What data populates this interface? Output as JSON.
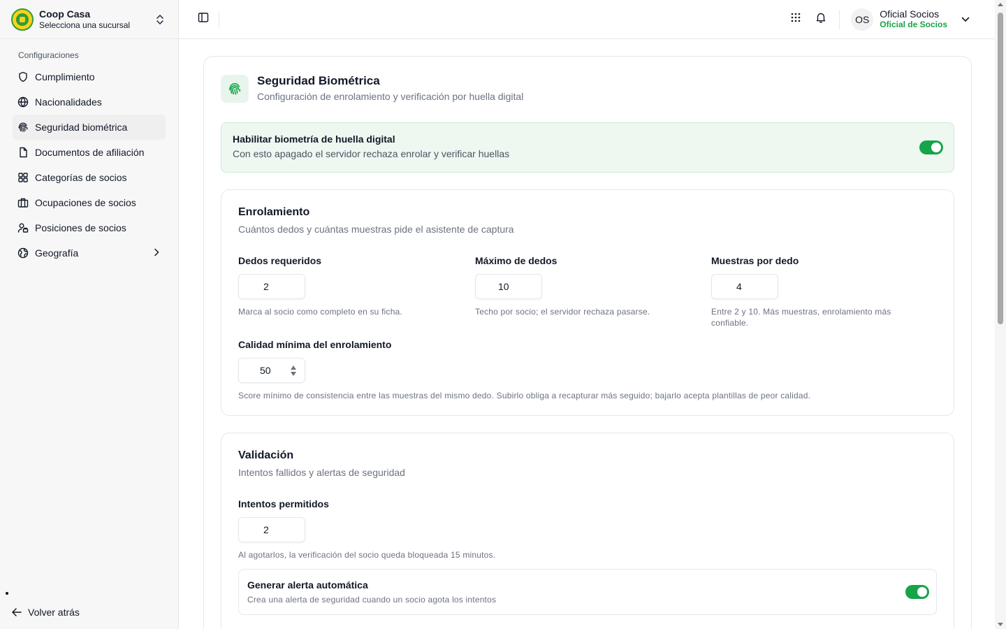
{
  "brand": {
    "name": "Coop Casa",
    "subtitle": "Selecciona una sucursal"
  },
  "sidebar": {
    "section_title": "Configuraciones",
    "items": [
      {
        "label": "Cumplimiento",
        "icon": "shield-icon"
      },
      {
        "label": "Nacionalidades",
        "icon": "globe-icon"
      },
      {
        "label": "Seguridad biométrica",
        "icon": "fingerprint-icon",
        "active": true
      },
      {
        "label": "Documentos de afiliación",
        "icon": "document-icon"
      },
      {
        "label": "Categorías de socios",
        "icon": "grid-icon"
      },
      {
        "label": "Ocupaciones de socios",
        "icon": "briefcase-icon"
      },
      {
        "label": "Posiciones de socios",
        "icon": "users-icon"
      },
      {
        "label": "Geografía",
        "icon": "earth-icon",
        "has_submenu": true
      }
    ],
    "back_label": "Volver atrás"
  },
  "topbar": {
    "user": {
      "initials": "OS",
      "name": "Oficial Socios",
      "role": "Oficial de Socios"
    }
  },
  "card": {
    "title": "Seguridad Biométrica",
    "subtitle": "Configuración de enrolamiento y verificación por huella digital",
    "enable": {
      "title": "Habilitar biometría de huella digital",
      "subtitle": "Con esto apagado el servidor rechaza enrolar y verificar huellas",
      "on": true
    },
    "enrollment": {
      "title": "Enrolamiento",
      "subtitle": "Cuántos dedos y cuántas muestras pide el asistente de captura",
      "fields": [
        {
          "label": "Dedos requeridos",
          "value": "2",
          "help": "Marca al socio como completo en su ficha."
        },
        {
          "label": "Máximo de dedos",
          "value": "10",
          "help": "Techo por socio; el servidor rechaza pasarse."
        },
        {
          "label": "Muestras por dedo",
          "value": "4",
          "help": "Entre 2 y 10. Más muestras, enrolamiento más confiable."
        }
      ],
      "quality": {
        "label": "Calidad mínima del enrolamiento",
        "value": "50",
        "help": "Score mínimo de consistencia entre las muestras del mismo dedo. Subirlo obliga a recapturar más seguido; bajarlo acepta plantillas de peor calidad."
      }
    },
    "validation": {
      "title": "Validación",
      "subtitle": "Intentos fallidos y alertas de seguridad",
      "attempts": {
        "label": "Intentos permitidos",
        "value": "2",
        "help": "Al agotarlos, la verificación del socio queda bloqueada 15 minutos."
      },
      "alert": {
        "title": "Generar alerta automática",
        "subtitle": "Crea una alerta de seguridad cuando un socio agota los intentos",
        "on": true
      }
    }
  },
  "colors": {
    "accent": "#16a34a",
    "accent_bg": "#eef8f1"
  }
}
